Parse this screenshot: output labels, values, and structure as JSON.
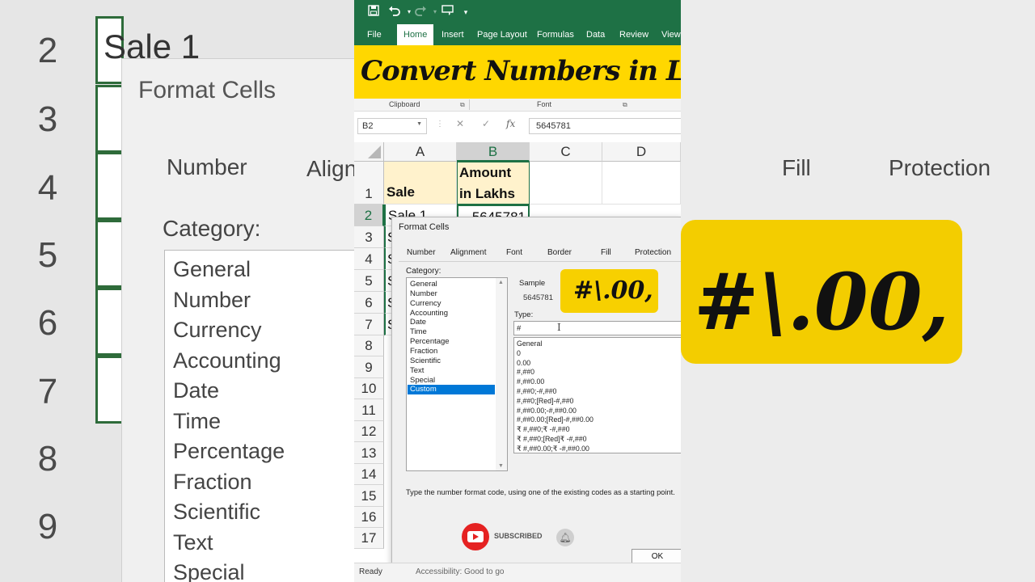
{
  "background": {
    "row_numbers": [
      "2",
      "3",
      "4",
      "5",
      "6",
      "7",
      "8",
      "9"
    ],
    "cell_text": "Sale 1",
    "dialog_title": "Format Cells",
    "tab_number": "Number",
    "tab_alignment": "Align",
    "tab_fill": "Fill",
    "tab_protection": "Protection",
    "category_label": "Category:",
    "categories": [
      "General",
      "Number",
      "Currency",
      "Accounting",
      "Date",
      "Time",
      "Percentage",
      "Fraction",
      "Scientific",
      "Text",
      "Special"
    ],
    "callout_text": "#\\.00,",
    "colors": {
      "callout": "#f3cd00"
    }
  },
  "qat": {
    "icons": [
      "save-icon",
      "undo-icon",
      "redo-icon",
      "touch-mode-icon",
      "customize-icon"
    ]
  },
  "ribbon": {
    "tabs": [
      "File",
      "Home",
      "Insert",
      "Page Layout",
      "Formulas",
      "Data",
      "Review",
      "View"
    ],
    "active_tab": "Home",
    "groups": [
      "Clipboard",
      "Font"
    ],
    "colors": {
      "ribbon": "#1e7145"
    }
  },
  "banner": {
    "text": "Convert Numbers in Lakhs",
    "colors": {
      "background": "#ffd700"
    }
  },
  "formula_bar": {
    "name_box": "B2",
    "fx": "fx",
    "value": "5645781"
  },
  "sheet": {
    "columns": [
      "A",
      "B",
      "C",
      "D"
    ],
    "rows": [
      "1",
      "2",
      "3",
      "4",
      "5",
      "6",
      "7",
      "8",
      "9",
      "10",
      "11",
      "12",
      "13",
      "14",
      "15",
      "16",
      "17"
    ],
    "header_a": "Sale",
    "header_b_line1": "Amount",
    "header_b_line2": "in Lakhs",
    "cell_a2": "Sale 1",
    "cell_b2": "5645781",
    "partial_s": "S"
  },
  "dialog": {
    "title": "Format Cells",
    "tabs": [
      "Number",
      "Alignment",
      "Font",
      "Border",
      "Fill",
      "Protection"
    ],
    "category_label": "Category:",
    "categories": [
      "General",
      "Number",
      "Currency",
      "Accounting",
      "Date",
      "Time",
      "Percentage",
      "Fraction",
      "Scientific",
      "Text",
      "Special",
      "Custom"
    ],
    "selected_category": "Custom",
    "sample_label": "Sample",
    "sample_value": "5645781",
    "callout_text": "#\\.00,",
    "type_label": "Type:",
    "type_value": "#",
    "formats": [
      "General",
      "0",
      "0.00",
      "#,##0",
      "#,##0.00",
      "#,##0;-#,##0",
      "#,##0;[Red]-#,##0",
      "#,##0.00;-#,##0.00",
      "#,##0.00;[Red]-#,##0.00",
      "₹ #,##0;₹ -#,##0",
      "₹ #,##0;[Red]₹ -#,##0",
      "₹ #,##0.00;₹ -#,##0.00"
    ],
    "hint": "Type the number format code, using one of the existing codes as a starting point.",
    "ok_label": "OK"
  },
  "subscribe": {
    "label": "SUBSCRIBED"
  },
  "status_bar": {
    "ready": "Ready",
    "accessibility": "Accessibility: Good to go"
  }
}
